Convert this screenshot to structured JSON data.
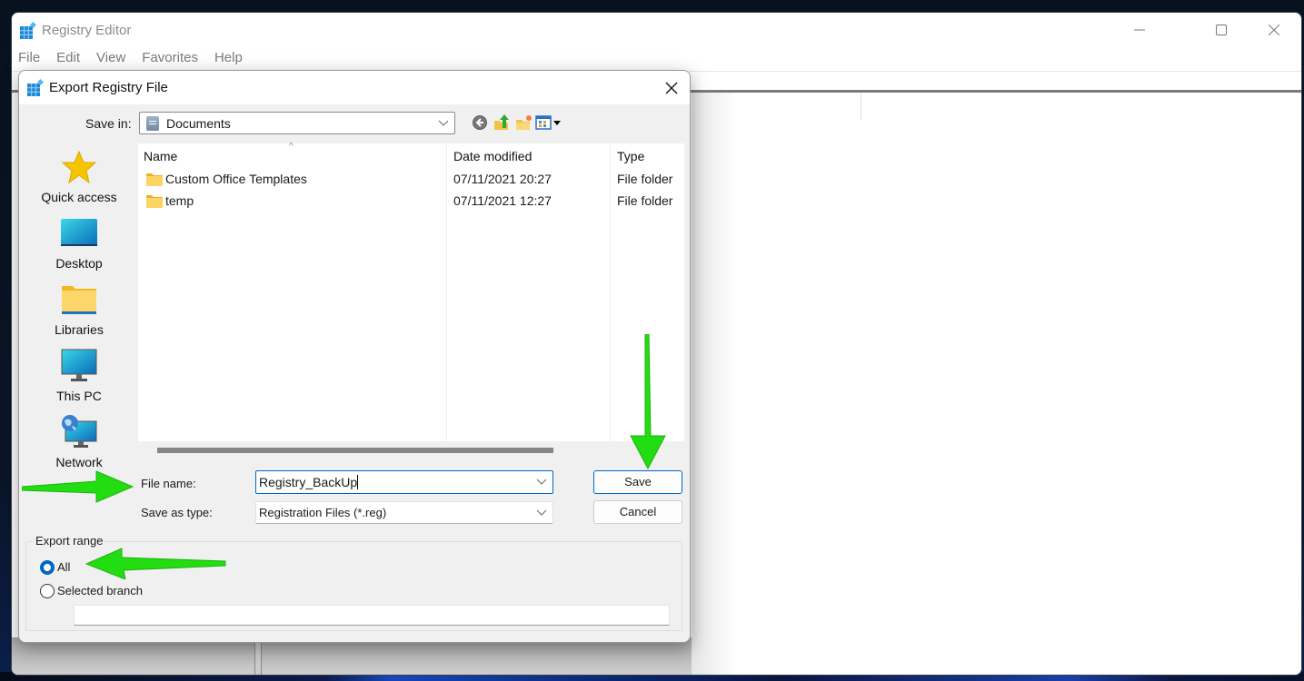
{
  "main_window": {
    "title": "Registry Editor",
    "menu": [
      "File",
      "Edit",
      "View",
      "Favorites",
      "Help"
    ],
    "controls": {
      "minimize": "minimize-icon",
      "maximize": "maximize-icon",
      "close": "close-icon"
    }
  },
  "dialog": {
    "title": "Export Registry File",
    "save_in": {
      "label": "Save in:",
      "value": "Documents",
      "icon": "documents-icon"
    },
    "toolbar": [
      {
        "name": "back",
        "icon": "back-arrow-icon"
      },
      {
        "name": "up-one-level",
        "icon": "folder-up-icon"
      },
      {
        "name": "new-folder",
        "icon": "new-folder-icon"
      },
      {
        "name": "view-menu",
        "icon": "view-menu-icon"
      }
    ],
    "places": [
      {
        "label": "Quick access",
        "icon": "star-icon"
      },
      {
        "label": "Desktop",
        "icon": "desktop-icon"
      },
      {
        "label": "Libraries",
        "icon": "libraries-folder-icon"
      },
      {
        "label": "This PC",
        "icon": "monitor-icon"
      },
      {
        "label": "Network",
        "icon": "network-icon"
      }
    ],
    "file_list": {
      "columns": [
        "Name",
        "Date modified",
        "Type"
      ],
      "rows": [
        {
          "name": "Custom Office Templates",
          "date": "07/11/2021 20:27",
          "type": "File folder"
        },
        {
          "name": "temp",
          "date": "07/11/2021 12:27",
          "type": "File folder"
        }
      ]
    },
    "file_name": {
      "label": "File name:",
      "value": "Registry_BackUp"
    },
    "save_as_type": {
      "label": "Save as type:",
      "value": "Registration Files (*.reg)"
    },
    "buttons": {
      "save": "Save",
      "cancel": "Cancel"
    },
    "export_range": {
      "legend": "Export range",
      "options": [
        {
          "label": "All",
          "selected": true
        },
        {
          "label": "Selected branch",
          "selected": false
        }
      ],
      "branch_value": ""
    }
  },
  "annotations": {
    "arrow_color": "#22dd11"
  },
  "colors": {
    "accent": "#0067c0",
    "dialog_bg": "#f0f0f0"
  }
}
